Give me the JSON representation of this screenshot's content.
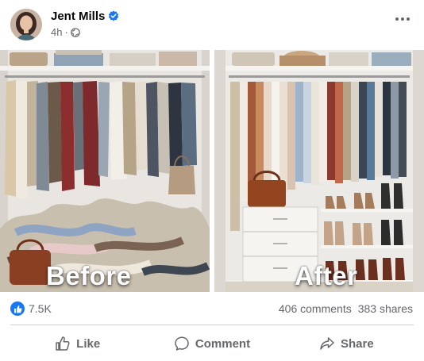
{
  "post": {
    "author": "Jent Mills",
    "time": "4h",
    "separator": "·",
    "audience_icon": "globe-icon",
    "verified_icon": "verified-badge-icon",
    "more_icon": "more-options-icon"
  },
  "images": {
    "before_caption": "Before",
    "after_caption": "After"
  },
  "engagement": {
    "reaction_icon": "like-reaction-icon",
    "reaction_count": "7.5K",
    "comments": "406 comments",
    "shares": "383 shares"
  },
  "actions": {
    "like": "Like",
    "comment": "Comment",
    "share": "Share"
  },
  "colors": {
    "accent": "#1877f2",
    "secondary_text": "#65676b",
    "divider": "#ced0d4"
  }
}
